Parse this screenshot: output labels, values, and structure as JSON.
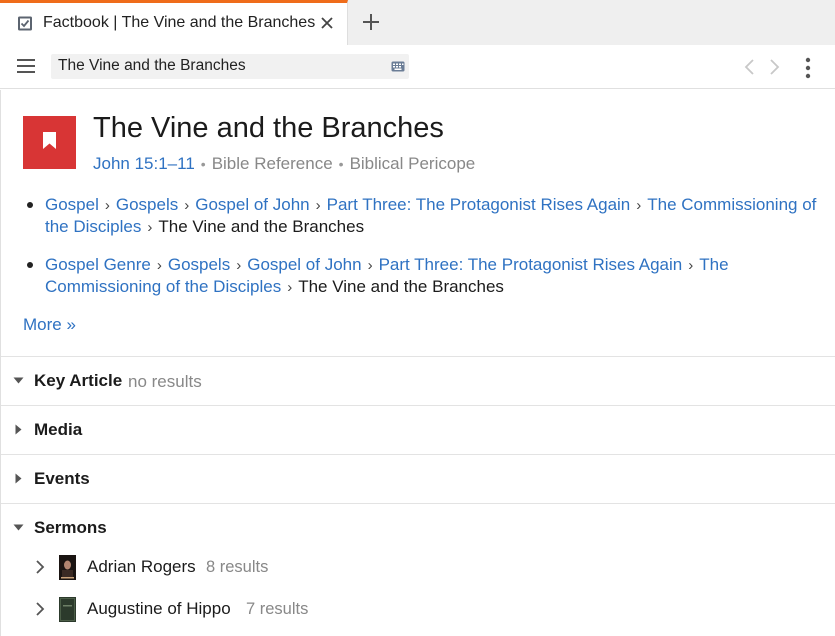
{
  "tab": {
    "title": "Factbook | The Vine and the Branches"
  },
  "toolbar": {
    "search_value": "The Vine and the Branches"
  },
  "header": {
    "title": "The Vine and the Branches",
    "reference": "John 15:1–11",
    "type1": "Bible Reference",
    "type2": "Biblical Pericope",
    "separator": "•"
  },
  "breadcrumbs": [
    {
      "links": [
        "Gospel",
        "Gospels",
        "Gospel of John",
        "Part Three: The Protagonist Rises Again",
        "The Commissioning of the Disciples"
      ],
      "current": "The Vine and the Branches"
    },
    {
      "links": [
        "Gospel Genre",
        "Gospels",
        "Gospel of John",
        "Part Three: The Protagonist Rises Again",
        "The Commissioning of the Disciples"
      ],
      "current": "The Vine and the Branches"
    }
  ],
  "breadcrumb_separator": "›",
  "more_link": "More »",
  "sections": {
    "key_article": {
      "title": "Key Article",
      "note": "no results"
    },
    "media": {
      "title": "Media"
    },
    "events": {
      "title": "Events"
    },
    "sermons": {
      "title": "Sermons"
    }
  },
  "sermons": [
    {
      "name": "Adrian Rogers",
      "count": "8 results"
    },
    {
      "name": "Augustine of Hippo",
      "count": "7 results"
    }
  ],
  "colors": {
    "accent": "#ef6c1a",
    "brand_red": "#d83535",
    "link": "#2f72c2"
  },
  "icons": {
    "tab": "factbook-check-icon",
    "close": "close-icon",
    "new_tab": "plus-icon",
    "menu": "hamburger-icon",
    "keyboard": "keyboard-icon",
    "back": "chevron-left-icon",
    "forward": "chevron-right-icon",
    "more": "vertical-dots-icon",
    "logo": "bookmark-icon"
  }
}
